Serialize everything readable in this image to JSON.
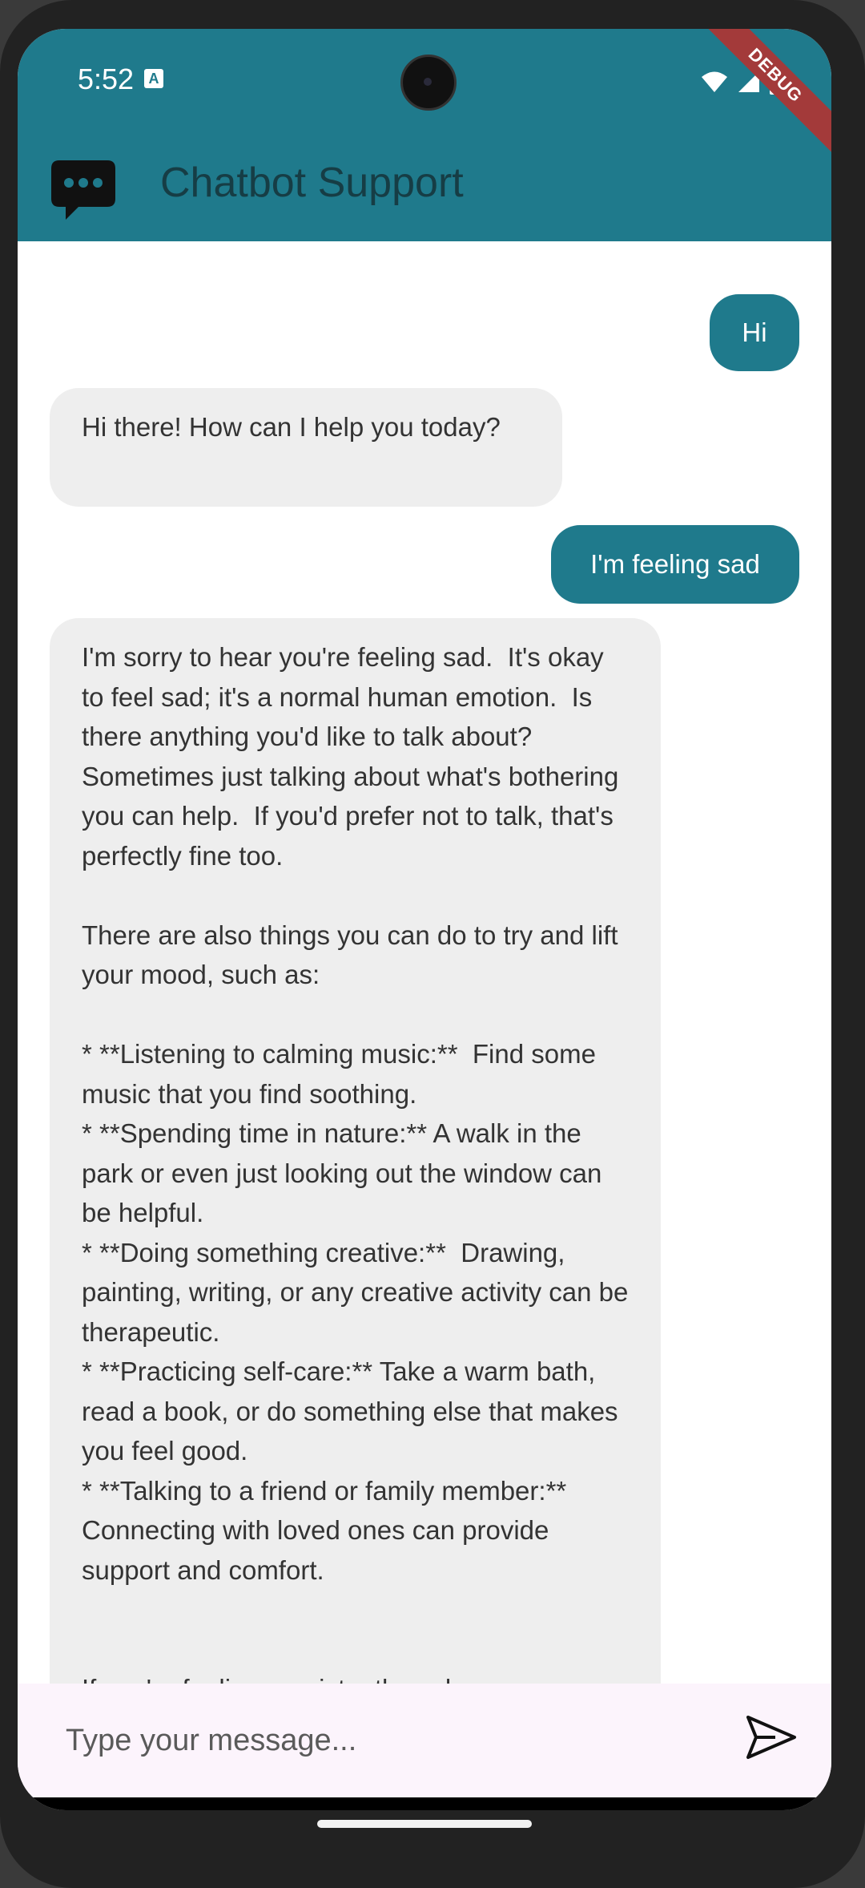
{
  "status_bar": {
    "time": "5:52",
    "badge": "A",
    "debug_label": "DEBUG"
  },
  "app_bar": {
    "title": "Chatbot Support",
    "logo_icon": "chat-bubble-icon",
    "color": "#1f7a8c"
  },
  "messages": [
    {
      "role": "user",
      "text": "Hi"
    },
    {
      "role": "bot",
      "text": "Hi there! How can I help you today?"
    },
    {
      "role": "user",
      "text": "I'm feeling sad"
    },
    {
      "role": "bot",
      "text": "I'm sorry to hear you're feeling sad.  It's okay to feel sad; it's a normal human emotion.  Is there anything you'd like to talk about?  Sometimes just talking about what's bothering you can help.  If you'd prefer not to talk, that's perfectly fine too.\n\nThere are also things you can do to try and lift your mood, such as:\n\n* **Listening to calming music:**  Find some music that you find soothing.\n* **Spending time in nature:** A walk in the park or even just looking out the window can be helpful.\n* **Doing something creative:**  Drawing, painting, writing, or any creative activity can be therapeutic.\n* **Practicing self-care:** Take a warm bath, read a book, or do something else that makes you feel good.\n* **Talking to a friend or family member:** Connecting with loved ones can provide support and comfort.\n\n\nIf you're feeling persistently sad or your"
    }
  ],
  "composer": {
    "placeholder": "Type your message...",
    "send_icon": "send-icon"
  }
}
